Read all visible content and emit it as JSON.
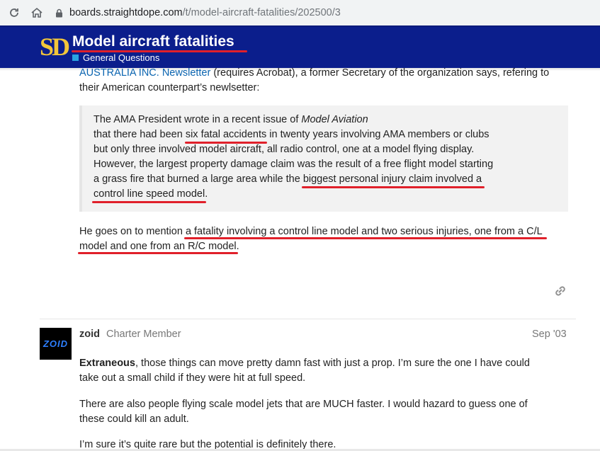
{
  "browser": {
    "url_host": "boards.straightdope.com",
    "url_path": "/t/model-aircraft-fatalities/202500/3",
    "reload_icon": "reload-icon",
    "home_icon": "home-icon",
    "lock_icon": "lock-icon"
  },
  "header": {
    "logo_text": "SD",
    "title": "Model aircraft fatalities",
    "category": "General Questions",
    "colors": {
      "bar": "#0b1e8c",
      "logo": "#f2c63a",
      "category": "#2aa3e0",
      "underline": "#e0202a"
    }
  },
  "post1": {
    "intro_link": "AUSTRALIA INC. Newsletter",
    "intro_rest": " (requires Acrobat), a former Secretary of the organization says, refering to",
    "intro_line2": "their American counterpart’s newlsetter:",
    "quote": {
      "l1_a": "The AMA President wrote in a recent issue of ",
      "l1_em": "Model Aviation",
      "l2_a": "that there had been ",
      "l2_hl": "six fatal accidents",
      "l2_b": " in twenty years involving AMA members or clubs",
      "l3": "but only three involved model aircraft, all radio control, one at a model flying display.",
      "l4": "However, the largest property damage claim was the result of a free flight model starting",
      "l5_a": "a grass fire that burned a large area while the ",
      "l5_hl": "biggest personal injury claim involved a",
      "l6_hl": "control line speed model",
      "l6_b": "."
    },
    "p2_a": "He goes on to mention ",
    "p2_hl": "a fatality involving a control line model and two serious injuries, one from a C/L",
    "p3_hl": "model and one from an R/C model",
    "p3_b": ".",
    "share_icon": "link-icon"
  },
  "post2": {
    "avatar_text": "ZOID",
    "username": "zoid",
    "user_title": "Charter Member",
    "date": "Sep '03",
    "p1_bold": "Extraneous",
    "p1_rest": ", those things can move pretty damn fast with just a prop. I’m sure the one I have could",
    "p1_line2": "take out a small child if they were hit at full speed.",
    "p2_line1": "There are also people flying scale model jets that are MUCH faster. I would hazard to guess one of",
    "p2_line2": "these could kill an adult.",
    "p3": "I’m sure it’s quite rare but the potential is definitely there."
  }
}
